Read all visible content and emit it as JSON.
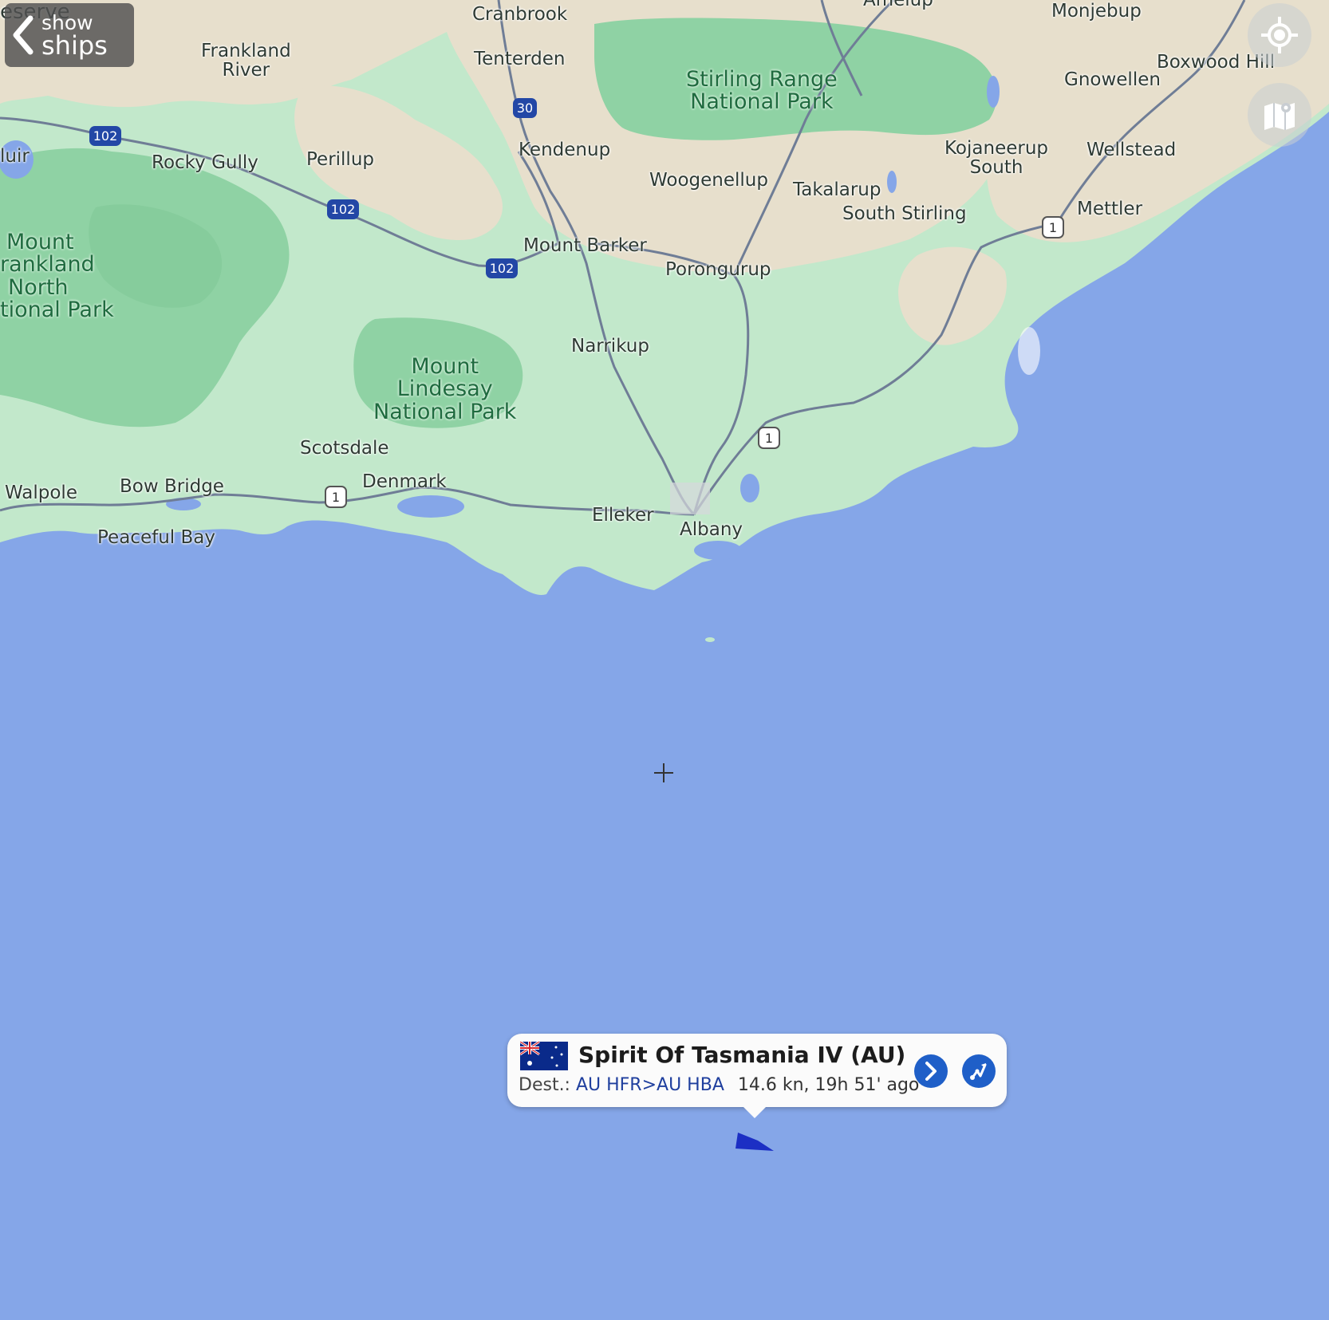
{
  "back_button": {
    "line1": "show",
    "line2": "ships",
    "icon": "chevron-left-icon"
  },
  "map_controls": {
    "locate_icon": "crosshair-locate-icon",
    "layers_icon": "map-layers-icon"
  },
  "places": {
    "reserve": "eserve",
    "cranbrook": "Cranbrook",
    "amelup": "Amelup",
    "monjebup": "Monjebup",
    "frankland_river_1": "Frankland",
    "frankland_river_2": "River",
    "tenterden": "Tenterden",
    "gnowellen": "Gnowellen",
    "boxwood_hill": "Boxwood Hill",
    "muir": "luir",
    "rocky_gully": "Rocky Gully",
    "perillup": "Perillup",
    "kendenup": "Kendenup",
    "woogenellup": "Woogenellup",
    "takalarup": "Takalarup",
    "kojaneerup_1": "Kojaneerup",
    "kojaneerup_2": "South",
    "wellstead": "Wellstead",
    "south_stirling": "South Stirling",
    "mettler": "Mettler",
    "mount_barker": "Mount Barker",
    "porongurup": "Porongurup",
    "narrikup": "Narrikup",
    "scotsdale": "Scotsdale",
    "denmark": "Denmark",
    "walpole": "Walpole",
    "bow_bridge": "Bow Bridge",
    "peaceful_bay": "Peaceful Bay",
    "elleker": "Elleker",
    "albany": "Albany"
  },
  "parks": {
    "stirling_1": "Stirling Range",
    "stirling_2": "National Park",
    "frankland_1": "Mount",
    "frankland_2": "rankland",
    "frankland_3": "North",
    "frankland_4": "tional Park",
    "lindesay_1": "Mount",
    "lindesay_2": "Lindesay",
    "lindesay_3": "National Park"
  },
  "road_shields": {
    "r102": "102",
    "r30": "30",
    "r1": "1"
  },
  "colors": {
    "water": "#85a6e8",
    "land": "#bfe6c8",
    "farmland": "#e6dfcc",
    "park": "#8ed3a3",
    "road": "#6f7d96",
    "ship": "#1c2fc4",
    "accent": "#1f5fc8"
  },
  "ship_popup": {
    "flag": "australia-flag",
    "name": "Spirit Of Tasmania IV (AU)",
    "dest_label": "Dest.:",
    "dest_value": "AU HFR>AU HBA",
    "speed_time": "14.6 kn, 19h 51' ago",
    "details_icon": "chevron-right-icon",
    "route_icon": "route-icon"
  },
  "ship_marker": {
    "icon": "ship-arrow-icon"
  },
  "map_center": {
    "icon": "crosshair-icon"
  }
}
